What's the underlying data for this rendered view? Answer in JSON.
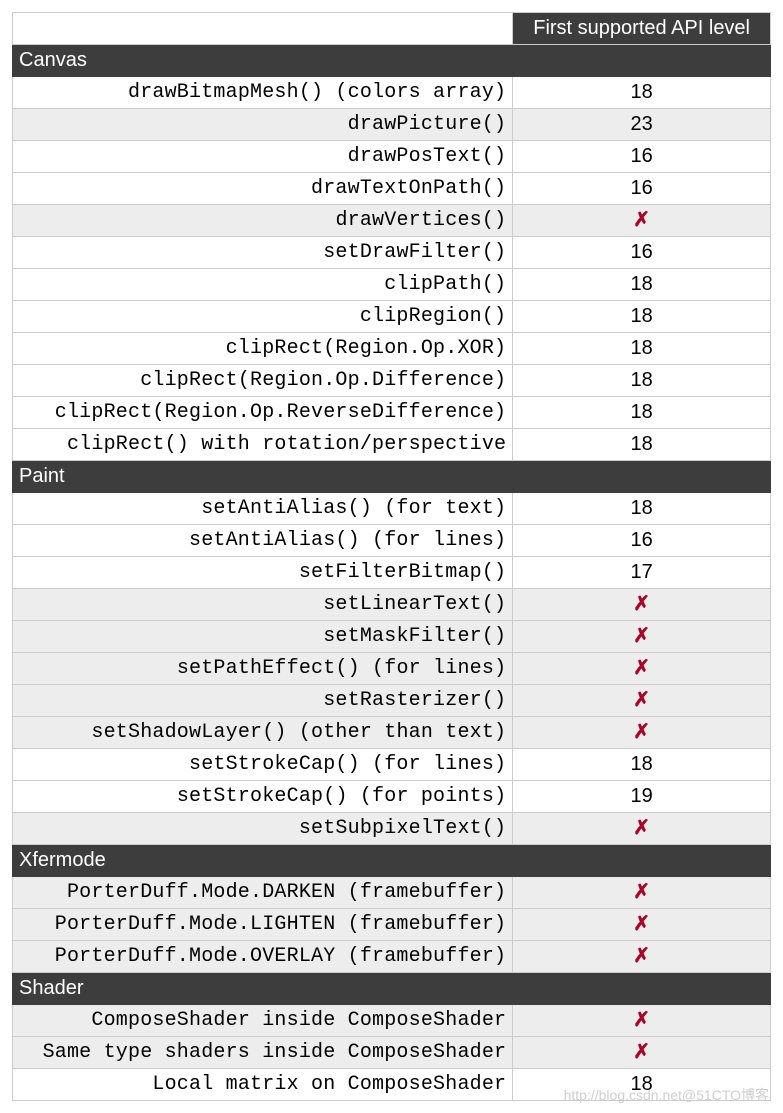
{
  "header": {
    "api_col": "First supported API level"
  },
  "cross_symbol": "✗",
  "watermark": "http://blog.csdn.net@51CTO博客",
  "sections": [
    {
      "title": "Canvas",
      "rows": [
        {
          "method": "drawBitmapMesh() (colors array)",
          "api": "18",
          "alt": false
        },
        {
          "method": "drawPicture()",
          "api": "23",
          "alt": true
        },
        {
          "method": "drawPosText()",
          "api": "16",
          "alt": false
        },
        {
          "method": "drawTextOnPath()",
          "api": "16",
          "alt": false
        },
        {
          "method": "drawVertices()",
          "api": "X",
          "alt": true
        },
        {
          "method": "setDrawFilter()",
          "api": "16",
          "alt": false
        },
        {
          "method": "clipPath()",
          "api": "18",
          "alt": false
        },
        {
          "method": "clipRegion()",
          "api": "18",
          "alt": false
        },
        {
          "method": "clipRect(Region.Op.XOR)",
          "api": "18",
          "alt": false
        },
        {
          "method": "clipRect(Region.Op.Difference)",
          "api": "18",
          "alt": false
        },
        {
          "method": "clipRect(Region.Op.ReverseDifference)",
          "api": "18",
          "alt": false
        },
        {
          "method": "clipRect() with rotation/perspective",
          "api": "18",
          "alt": false
        }
      ]
    },
    {
      "title": "Paint",
      "rows": [
        {
          "method": "setAntiAlias() (for text)",
          "api": "18",
          "alt": false
        },
        {
          "method": "setAntiAlias() (for lines)",
          "api": "16",
          "alt": false
        },
        {
          "method": "setFilterBitmap()",
          "api": "17",
          "alt": false
        },
        {
          "method": "setLinearText()",
          "api": "X",
          "alt": true
        },
        {
          "method": "setMaskFilter()",
          "api": "X",
          "alt": true
        },
        {
          "method": "setPathEffect() (for lines)",
          "api": "X",
          "alt": true
        },
        {
          "method": "setRasterizer()",
          "api": "X",
          "alt": true
        },
        {
          "method": "setShadowLayer() (other than text)",
          "api": "X",
          "alt": true
        },
        {
          "method": "setStrokeCap() (for lines)",
          "api": "18",
          "alt": false
        },
        {
          "method": "setStrokeCap() (for points)",
          "api": "19",
          "alt": false
        },
        {
          "method": "setSubpixelText()",
          "api": "X",
          "alt": true
        }
      ]
    },
    {
      "title": "Xfermode",
      "rows": [
        {
          "method": "PorterDuff.Mode.DARKEN (framebuffer)",
          "api": "X",
          "alt": true
        },
        {
          "method": "PorterDuff.Mode.LIGHTEN (framebuffer)",
          "api": "X",
          "alt": true
        },
        {
          "method": "PorterDuff.Mode.OVERLAY (framebuffer)",
          "api": "X",
          "alt": true
        }
      ]
    },
    {
      "title": "Shader",
      "rows": [
        {
          "method": "ComposeShader inside ComposeShader",
          "api": "X",
          "alt": true
        },
        {
          "method": "Same type shaders inside ComposeShader",
          "api": "X",
          "alt": true
        },
        {
          "method": "Local matrix on ComposeShader",
          "api": "18",
          "alt": false
        }
      ]
    }
  ]
}
